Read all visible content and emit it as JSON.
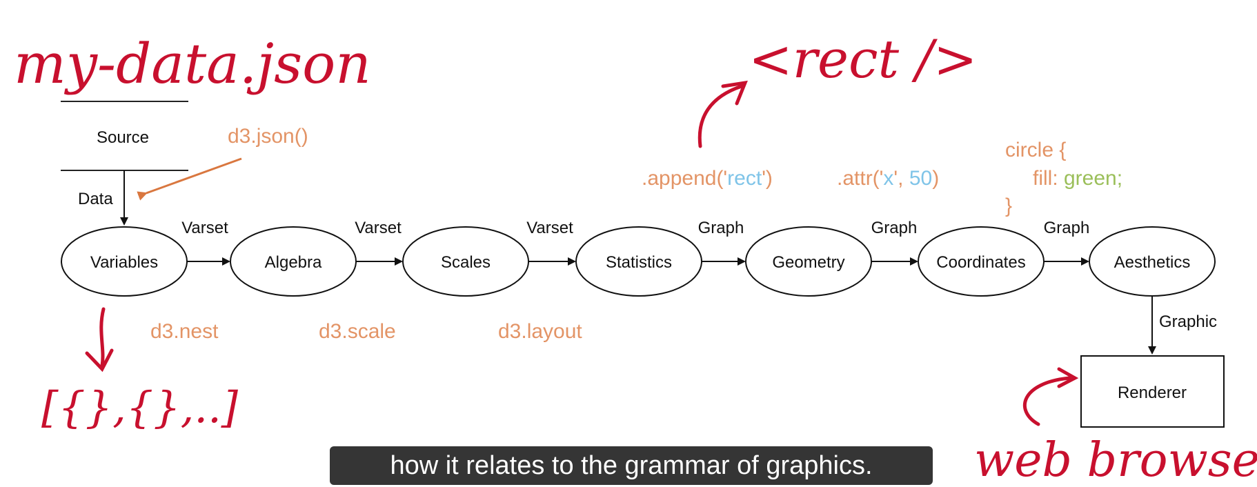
{
  "colors": {
    "d3_annotation": "#e39466",
    "handwriting": "#c8102e",
    "node_stroke": "#111111",
    "blue_string": "#7fc4e8",
    "green_value": "#9bbf5a"
  },
  "handwritten": {
    "file": "my-data.json",
    "element": "<rect />",
    "array": "[{},{},..]",
    "browser": "web browser"
  },
  "source": {
    "label": "Source"
  },
  "data_edge": {
    "label": "Data"
  },
  "nodes": [
    {
      "id": "variables",
      "label": "Variables"
    },
    {
      "id": "algebra",
      "label": "Algebra"
    },
    {
      "id": "scales",
      "label": "Scales"
    },
    {
      "id": "statistics",
      "label": "Statistics"
    },
    {
      "id": "geometry",
      "label": "Geometry"
    },
    {
      "id": "coordinates",
      "label": "Coordinates"
    },
    {
      "id": "aesthetics",
      "label": "Aesthetics"
    }
  ],
  "edges": [
    "Varset",
    "Varset",
    "Varset",
    "Graph",
    "Graph",
    "Graph"
  ],
  "graphic_edge": {
    "label": "Graphic"
  },
  "renderer": {
    "label": "Renderer"
  },
  "d3": {
    "json": "d3.json()",
    "nest": "d3.nest",
    "scale": "d3.scale",
    "layout": "d3.layout",
    "append_pre": ".append('",
    "append_str": "rect",
    "append_post": "')",
    "attr_pre": ".attr('",
    "attr_str": "x",
    "attr_mid": "', ",
    "attr_num": "50",
    "attr_post": ")",
    "circle_open": "circle {",
    "fill_key": "fill: ",
    "fill_val": "green;",
    "circle_close": "}"
  },
  "caption": "how it relates to the grammar of graphics."
}
